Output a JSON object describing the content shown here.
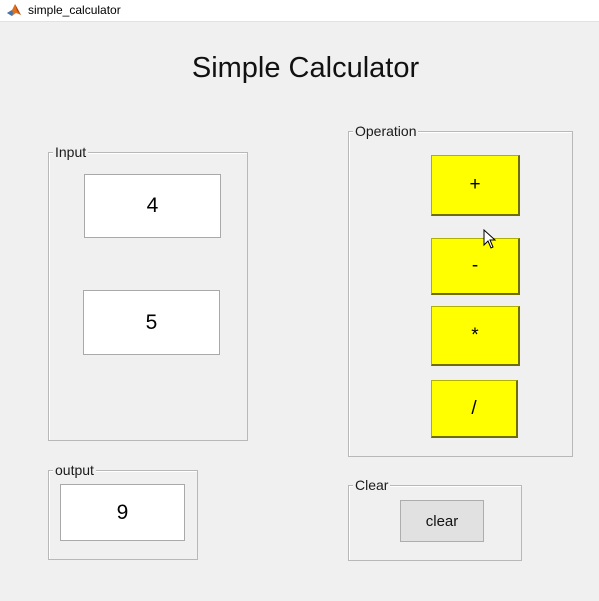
{
  "window": {
    "title": "simple_calculator",
    "icon": "matlab-icon"
  },
  "heading": "Simple Calculator",
  "input_panel": {
    "label": "Input",
    "value1": "4",
    "value2": "5"
  },
  "operation_panel": {
    "label": "Operation",
    "buttons": [
      {
        "label": "+"
      },
      {
        "label": "-"
      },
      {
        "label": "*"
      },
      {
        "label": "/"
      }
    ],
    "button_color": "#ffff00"
  },
  "output_panel": {
    "label": "output",
    "value": "9"
  },
  "clear_panel": {
    "label": "Clear",
    "button_label": "clear"
  }
}
